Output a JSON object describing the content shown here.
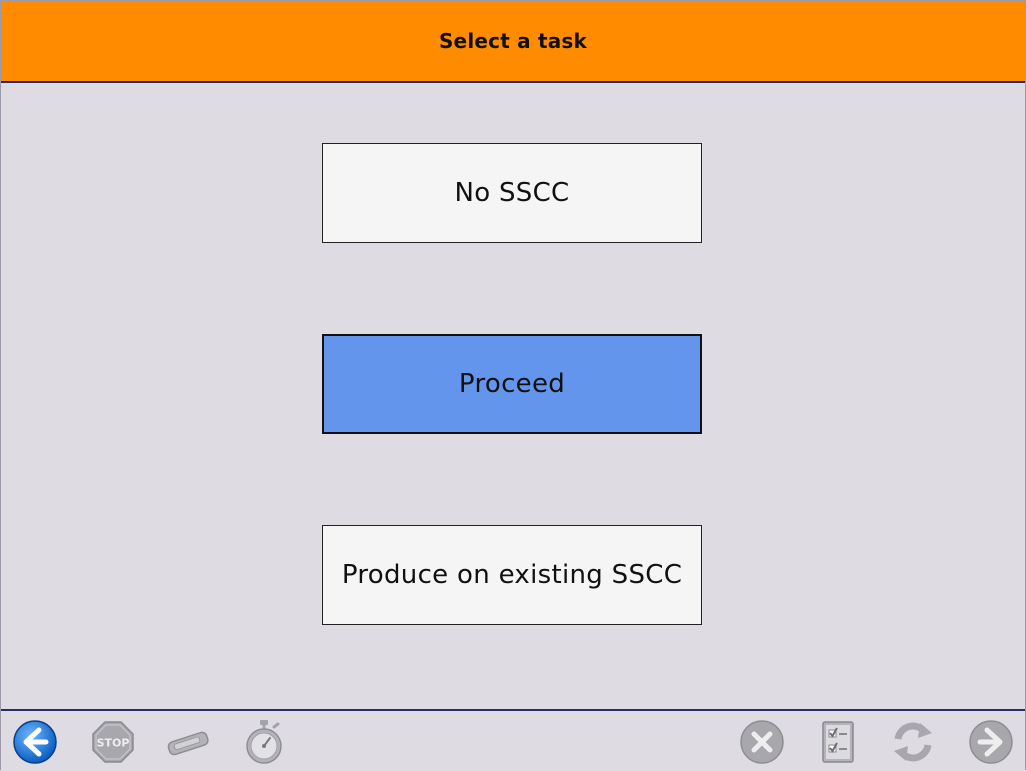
{
  "header": {
    "title": "Select a task"
  },
  "tasks": [
    {
      "label": "No SSCC",
      "selected": false
    },
    {
      "label": "Proceed",
      "selected": true
    },
    {
      "label": "Produce on existing SSCC",
      "selected": false
    }
  ],
  "colors": {
    "header_bg": "#ff8c00",
    "selected_bg": "#6495ed",
    "button_bg": "#f5f5f5",
    "page_bg": "#dedce2"
  },
  "toolbar": {
    "left": [
      {
        "icon": "back-arrow-icon",
        "enabled": true
      },
      {
        "icon": "stop-sign-icon",
        "label": "STOP",
        "enabled": false
      },
      {
        "icon": "scanner-icon",
        "enabled": false
      },
      {
        "icon": "stopwatch-icon",
        "enabled": false
      }
    ],
    "right": [
      {
        "icon": "cancel-x-icon",
        "enabled": false
      },
      {
        "icon": "checklist-icon",
        "enabled": false
      },
      {
        "icon": "refresh-icon",
        "enabled": false
      },
      {
        "icon": "forward-arrow-icon",
        "enabled": false
      }
    ]
  }
}
